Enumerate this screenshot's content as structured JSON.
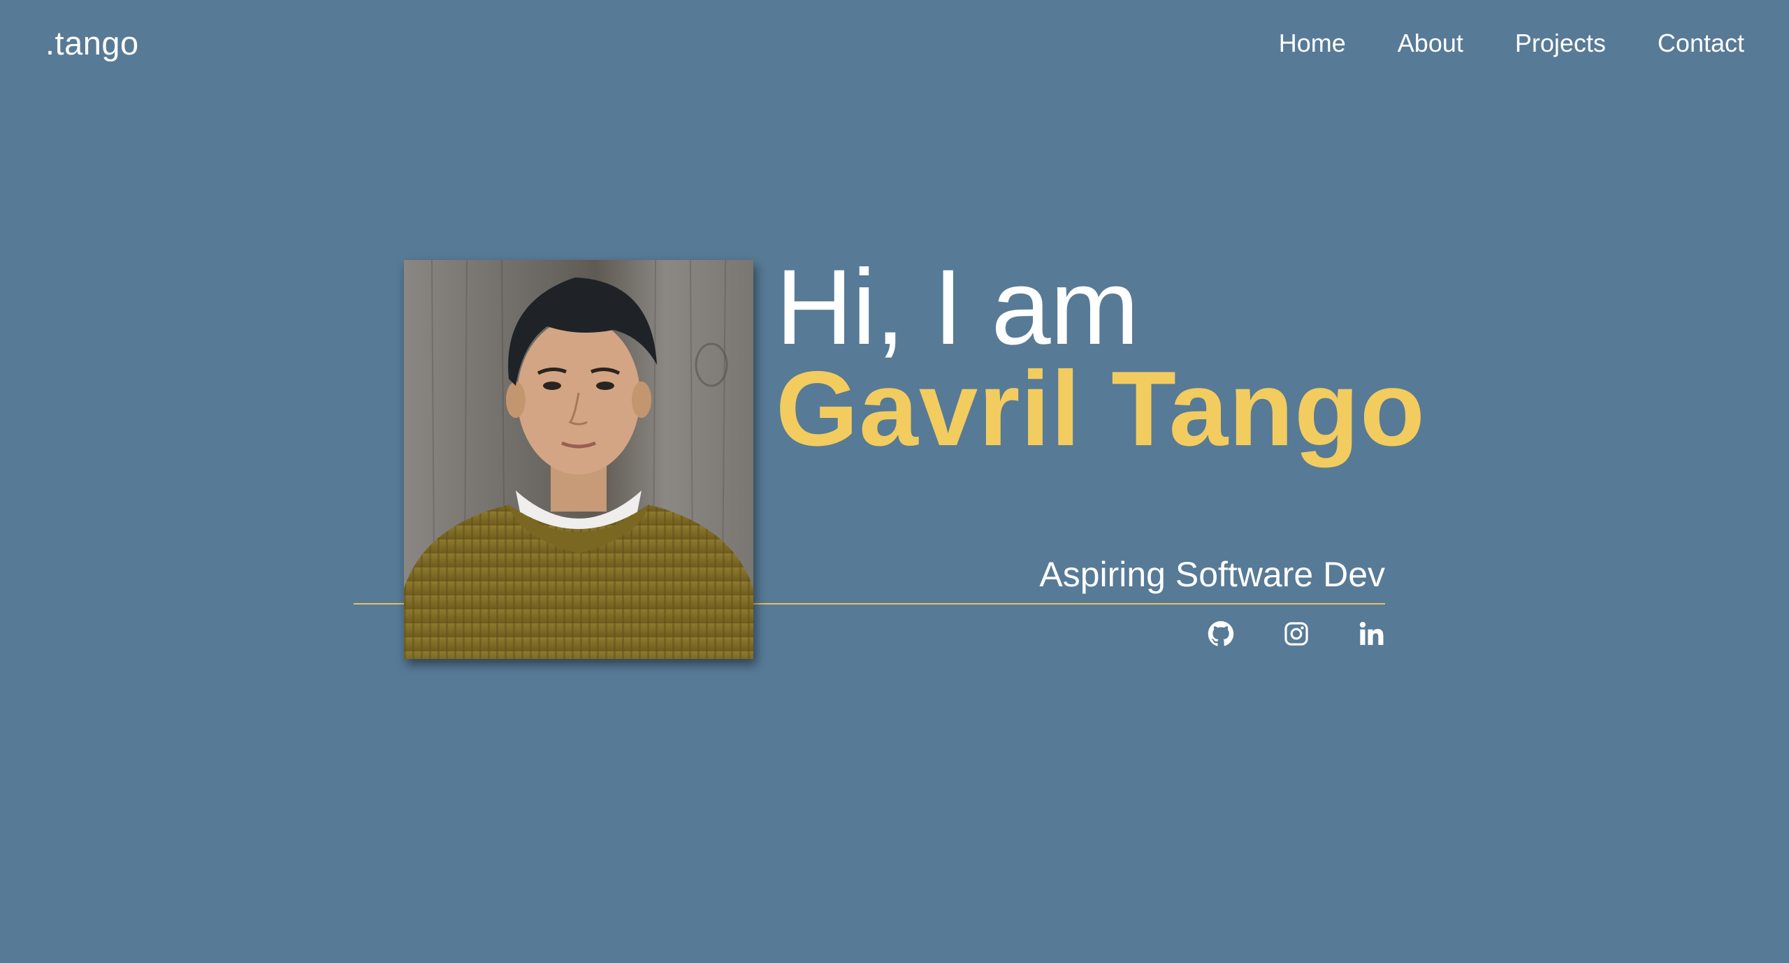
{
  "brand": {
    "label": ".tango"
  },
  "nav": {
    "items": [
      {
        "label": "Home"
      },
      {
        "label": "About"
      },
      {
        "label": "Projects"
      },
      {
        "label": "Contact"
      }
    ]
  },
  "hero": {
    "greeting": "Hi, I am",
    "name": "Gavril Tango",
    "tagline": "Aspiring Software Dev",
    "photo_alt": "portrait-photo",
    "social": [
      {
        "icon": "github-icon"
      },
      {
        "icon": "instagram-icon"
      },
      {
        "icon": "linkedin-icon"
      }
    ]
  },
  "colors": {
    "background": "#577a96",
    "accent": "#f2cc5f",
    "divider": "#e4c45e",
    "text": "#ffffff"
  }
}
